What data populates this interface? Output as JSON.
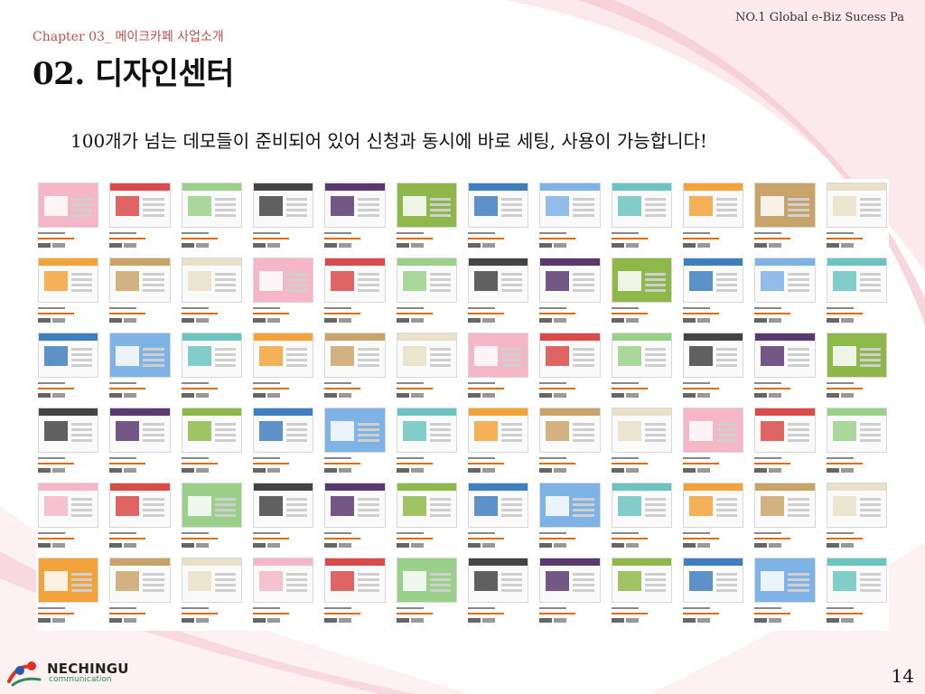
{
  "header": {
    "slogan": "NO.1 Global e-Biz Sucess Pa",
    "chapter": "Chapter 03_ 메이크카페 사업소개",
    "title": "02. 디자인센터"
  },
  "body": {
    "text": "100개가 넘는 데모들이 준비되어 있어 신청과 동시에 바로 세팅, 사용이 가능합니다!"
  },
  "footer": {
    "logo_name": "NECHINGU",
    "logo_sub": "communication",
    "page_number": "14"
  },
  "colors": {
    "chapter": "#c0504d",
    "accent_pink": "#f3c6cf"
  }
}
